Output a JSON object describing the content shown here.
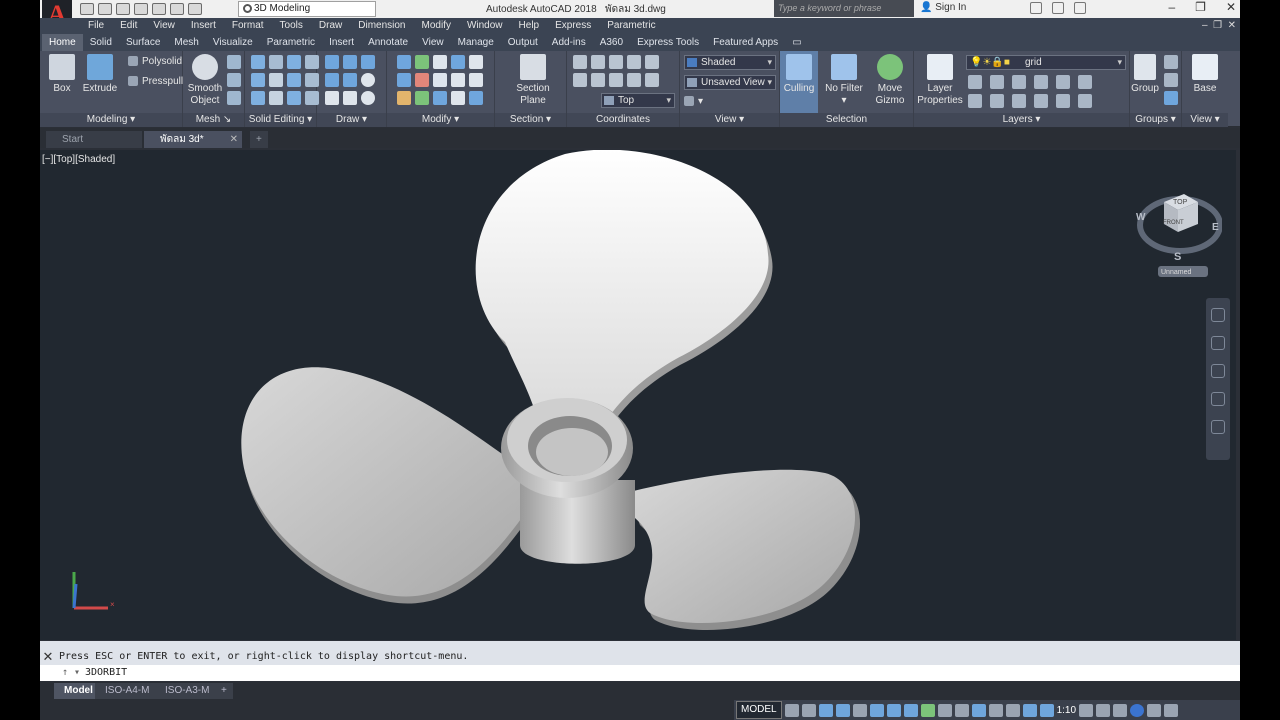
{
  "app": {
    "title": "Autodesk AutoCAD 2018",
    "file_name": "พัดลม 3d.dwg",
    "logo_letter": "A",
    "workspace": "3D Modeling",
    "search_placeholder": "Type a keyword or phrase",
    "sign_in": "Sign In",
    "accent": "#e23a31"
  },
  "menu": [
    "File",
    "Edit",
    "View",
    "Insert",
    "Format",
    "Tools",
    "Draw",
    "Dimension",
    "Modify",
    "Window",
    "Help",
    "Express",
    "Parametric"
  ],
  "ribbon_tabs": [
    "Home",
    "Solid",
    "Surface",
    "Mesh",
    "Visualize",
    "Parametric",
    "Insert",
    "Annotate",
    "View",
    "Manage",
    "Output",
    "Add-ins",
    "A360",
    "Express Tools",
    "Featured Apps"
  ],
  "ribbon": {
    "modeling": {
      "label": "Modeling",
      "box": "Box",
      "extrude": "Extrude",
      "polysolid": "Polysolid",
      "presspull": "Presspull"
    },
    "mesh": {
      "label": "Mesh",
      "smooth_object_1": "Smooth",
      "smooth_object_2": "Object"
    },
    "solid_editing": {
      "label": "Solid Editing"
    },
    "draw": {
      "label": "Draw"
    },
    "modify": {
      "label": "Modify"
    },
    "section": {
      "label": "Section",
      "section_plane_1": "Section",
      "section_plane_2": "Plane"
    },
    "coordinates": {
      "label": "Coordinates",
      "ucs_combo": "Top"
    },
    "view": {
      "label": "View",
      "visual_style": "Shaded",
      "saved_view": "Unsaved View"
    },
    "selection": {
      "label": "Selection",
      "culling": "Culling",
      "no_filter": "No Filter",
      "move_gizmo_1": "Move",
      "move_gizmo_2": "Gizmo"
    },
    "layers": {
      "label": "Layers",
      "layer_properties_1": "Layer",
      "layer_properties_2": "Properties",
      "current_layer": "grid"
    },
    "groups": {
      "label": "Groups",
      "group": "Group"
    },
    "view2": {
      "label": "View",
      "base": "Base"
    }
  },
  "file_tabs": [
    {
      "label": "Start"
    },
    {
      "label": "พัดลม 3d*"
    }
  ],
  "viewport": {
    "label": "[−][Top][Shaded]",
    "viewcube": {
      "top": "TOP",
      "front": "FRONT",
      "west": "W",
      "east": "E",
      "south": "S",
      "ucs_name": "Unnamed"
    }
  },
  "command": {
    "history": "Press ESC or ENTER to exit, or right-click to display shortcut-menu.",
    "current": "3DORBIT"
  },
  "layout_tabs": [
    "Model",
    "ISO-A4-M",
    "ISO-A3-M"
  ],
  "status": {
    "model": "MODEL",
    "scale": "1:10"
  }
}
